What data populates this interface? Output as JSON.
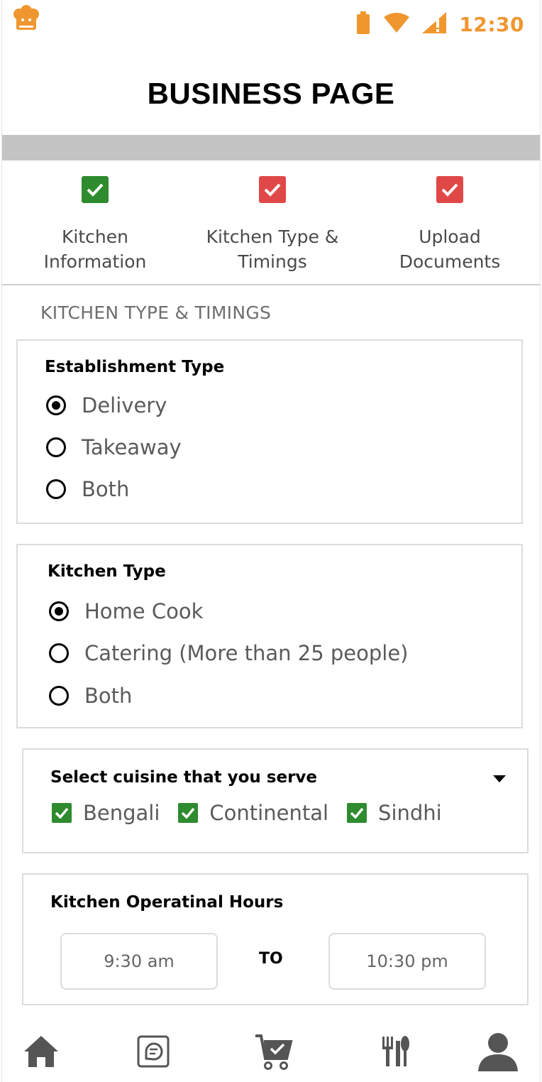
{
  "status_bar": {
    "time": "12:30",
    "icons": [
      "battery-icon",
      "wifi-icon",
      "cell-signal-icon"
    ],
    "accent_color": "#f0962f"
  },
  "header": {
    "title": "BUSINESS PAGE",
    "app_icon": "chef-logo-icon"
  },
  "steps": [
    {
      "label_line1": "Kitchen",
      "label_line2": "Information",
      "status_color": "#2e8b2e"
    },
    {
      "label_line1": "Kitchen Type &",
      "label_line2": "Timings",
      "status_color": "#e04848"
    },
    {
      "label_line1": "Upload",
      "label_line2": "Documents",
      "status_color": "#e04848"
    }
  ],
  "section_heading": "KITCHEN TYPE & TIMINGS",
  "establishment": {
    "title": "Establishment Type",
    "options": [
      {
        "label": "Delivery",
        "selected": true
      },
      {
        "label": "Takeaway",
        "selected": false
      },
      {
        "label": "Both",
        "selected": false
      }
    ]
  },
  "kitchen_type": {
    "title": "Kitchen Type",
    "options": [
      {
        "label": "Home Cook",
        "selected": true
      },
      {
        "label": "Catering (More than 25 people)",
        "selected": false
      },
      {
        "label": "Both",
        "selected": false
      }
    ]
  },
  "cuisine": {
    "title": "Select cuisine that you serve",
    "selected": [
      "Bengali",
      "Continental",
      "Sindhi"
    ]
  },
  "hours": {
    "title": "Kitchen Operatinal Hours",
    "from": "9:30 am",
    "separator": "TO",
    "to": "10:30 pm"
  },
  "bottom_nav": [
    "home-icon",
    "chat-icon",
    "cart-check-icon",
    "fork-knife-icon",
    "profile-icon"
  ]
}
